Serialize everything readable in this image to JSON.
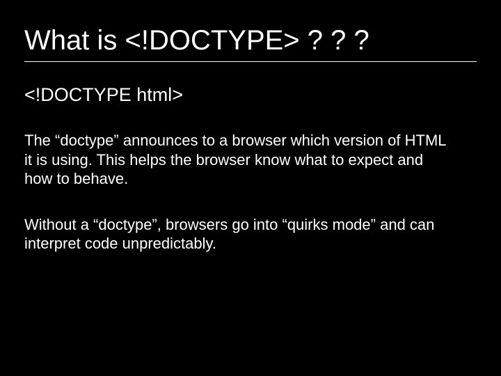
{
  "slide": {
    "title": "What is <!DOCTYPE>  ? ? ?",
    "doctype_line": "<!DOCTYPE html>",
    "para1": "The “doctype” announces to a browser which version of HTML it is using. This helps the browser know what to expect and how to behave.",
    "para2": "Without a “doctype”, browsers go into “quirks mode” and can interpret code unpredictably."
  }
}
